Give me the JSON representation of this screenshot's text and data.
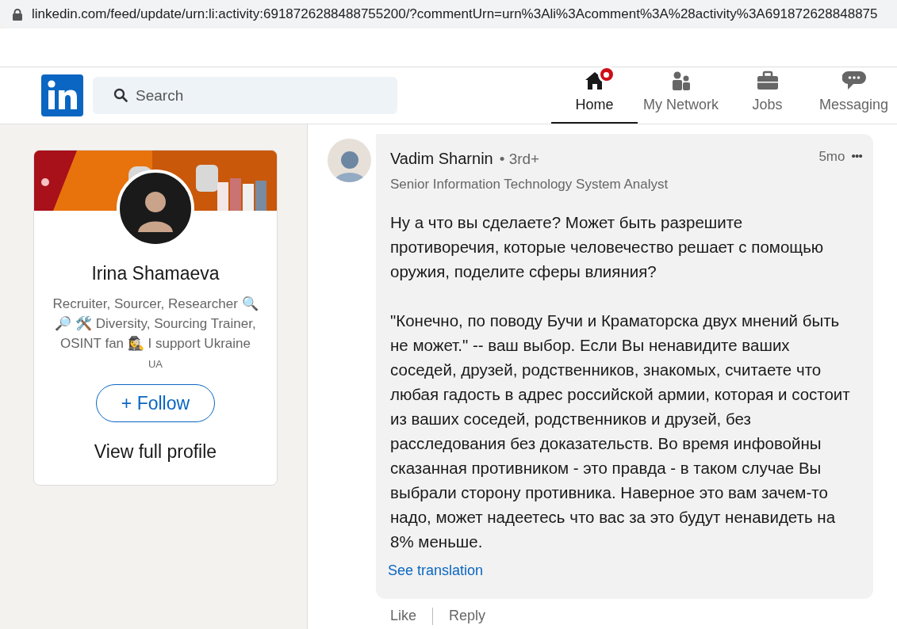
{
  "browser": {
    "url": "linkedin.com/feed/update/urn:li:activity:6918726288488755200/?commentUrn=urn%3Ali%3Acomment%3A%28activity%3A691872628848875"
  },
  "nav": {
    "search": {
      "placeholder": "Search"
    },
    "items": [
      {
        "kind": "home",
        "label": "Home",
        "selected": true,
        "badge": true
      },
      {
        "kind": "network",
        "label": "My Network",
        "selected": false,
        "badge": false
      },
      {
        "kind": "jobs",
        "label": "Jobs",
        "selected": false,
        "badge": false
      },
      {
        "kind": "messaging",
        "label": "Messaging",
        "selected": false,
        "badge": false
      }
    ]
  },
  "profile_card": {
    "name": "Irina Shamaeva",
    "headline": "Recruiter, Sourcer, Researcher 🔍 🔎 🛠️ Diversity, Sourcing Trainer, OSINT fan 🕵️‍♀️ I support Ukraine",
    "location": "UA",
    "follow_button": "+ Follow",
    "view_profile": "View full profile"
  },
  "comment": {
    "author": "Vadim Sharnin",
    "degree": "• 3rd+",
    "title": "Senior Information Technology System Analyst",
    "time": "5mo",
    "more": "•••",
    "paragraphs": [
      "Ну а что вы сделаете? Может быть разрешите противоречия, которые человечество решает с помощью оружия, поделите сферы влияния?",
      "\"Конечно, по поводу Бучи и Краматорска двух мнений быть не может.\" -- ваш выбор. Если Вы ненавидите ваших соседей, друзей, родственников, знакомых, считаете что любая гадость в адрес российской армии, которая и состоит из ваших соседей, родственников и друзей, без расследования без доказательств. Во время инфовойны сказанная противником - это правда - в таком случае Вы выбрали сторону противника. Наверное это вам зачем-то надо, может надеетесь что вас за это будут ненавидеть на 8% меньше."
    ],
    "see_translation": "See translation",
    "actions": [
      "Like",
      "Reply"
    ]
  }
}
